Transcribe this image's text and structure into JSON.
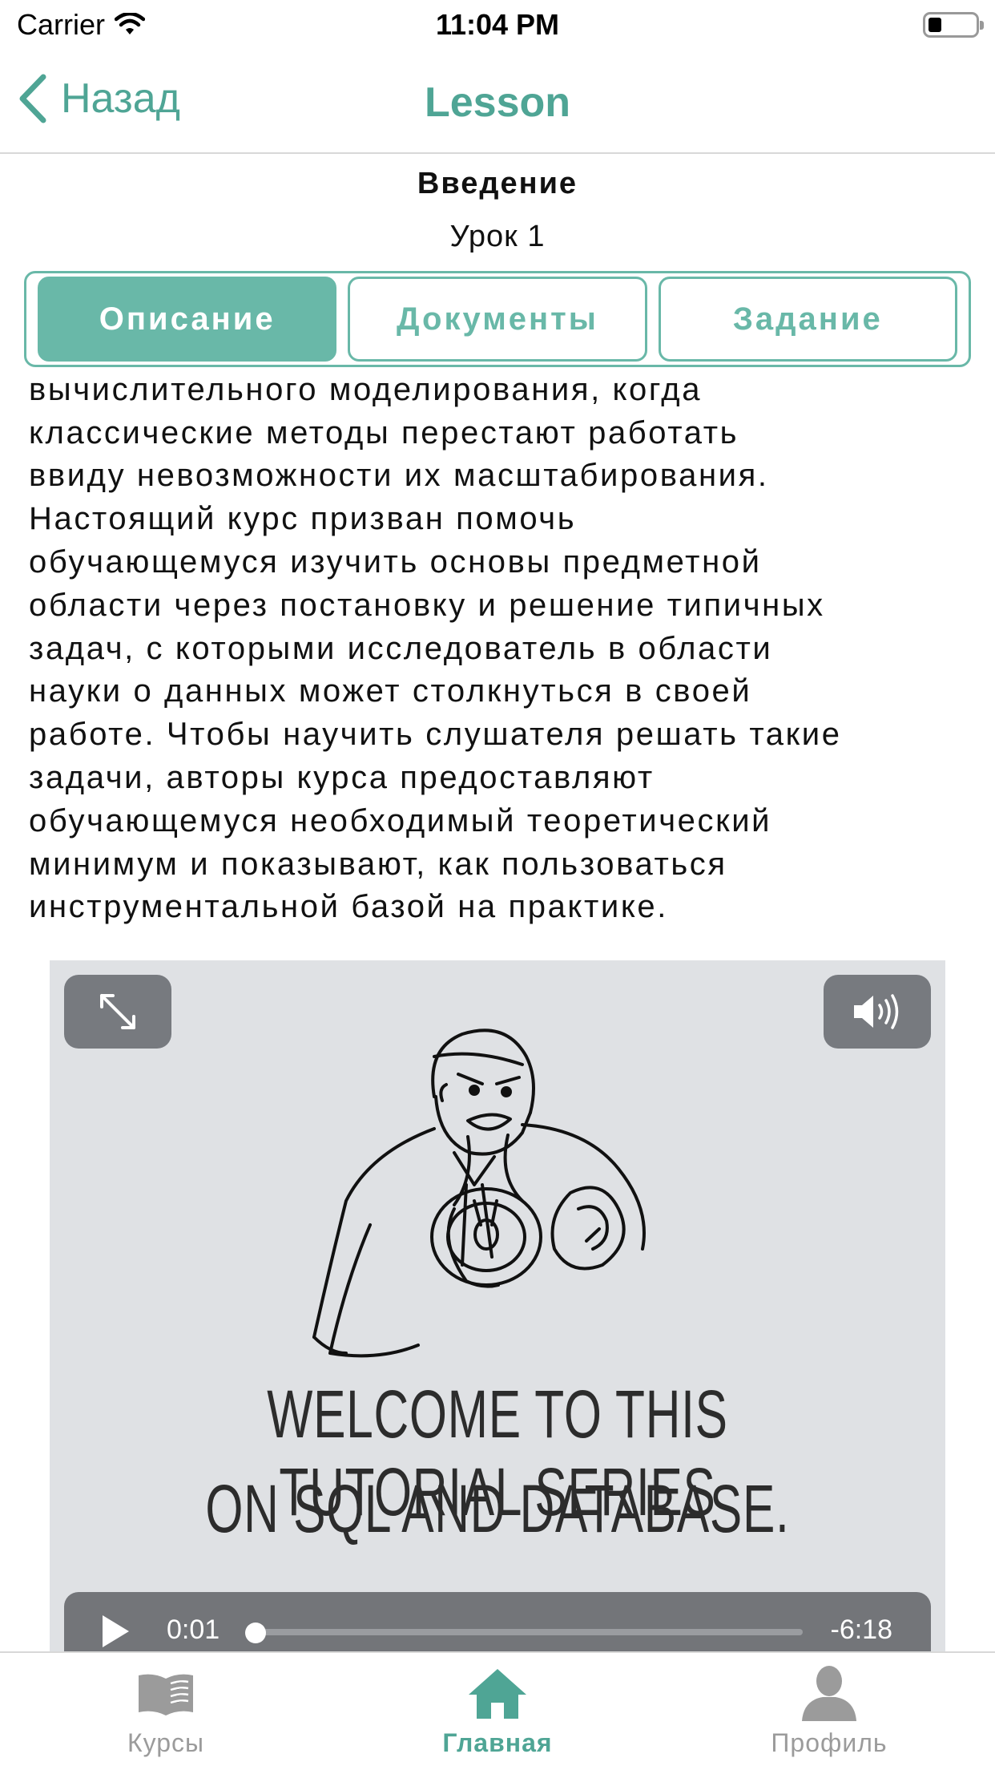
{
  "status_bar": {
    "carrier": "Carrier",
    "time": "11:04 PM",
    "wifi_icon": "wifi-icon",
    "battery_icon": "battery-icon"
  },
  "nav": {
    "back_label": "Назад",
    "back_icon": "chevron-left-icon",
    "title": "Lesson",
    "accent_color": "#4fa595"
  },
  "lesson": {
    "title": "Введение",
    "subtitle": "Урок 1"
  },
  "tabs": [
    {
      "label": "Описание",
      "active": true
    },
    {
      "label": "Документы",
      "active": false
    },
    {
      "label": "Задание",
      "active": false
    }
  ],
  "description": "провести\nвычислительного моделирования, когда\nклассические методы перестают работать\nввиду невозможности их масштабирования.\nНастоящий курс призван помочь\nобучающемуся изучить основы предметной\nобласти через постановку и решение типичных\nзадач, с которыми исследователь в области\nнауки о данных может столкнуться в своей\nработе. Чтобы научить слушателя решать такие\nзадачи, авторы курса предоставляют\nобучающемуся необходимый теоретический\nминимум и показывают, как пользоваться\nинструментальной базой на практике.",
  "video": {
    "caption_line1": "WELCOME TO THIS TUTORIAL SERIES",
    "caption_line2": "ON SQL AND DATABASE.",
    "current_time": "0:01",
    "remaining_time": "-6:18",
    "progress": 0.003,
    "fullscreen_icon": "expand-icon",
    "volume_icon": "speaker-icon",
    "play_icon": "play-icon"
  },
  "tab_bar": [
    {
      "label": "Курсы",
      "icon": "book-icon",
      "active": false
    },
    {
      "label": "Главная",
      "icon": "home-icon",
      "active": true
    },
    {
      "label": "Профиль",
      "icon": "person-icon",
      "active": false
    }
  ]
}
